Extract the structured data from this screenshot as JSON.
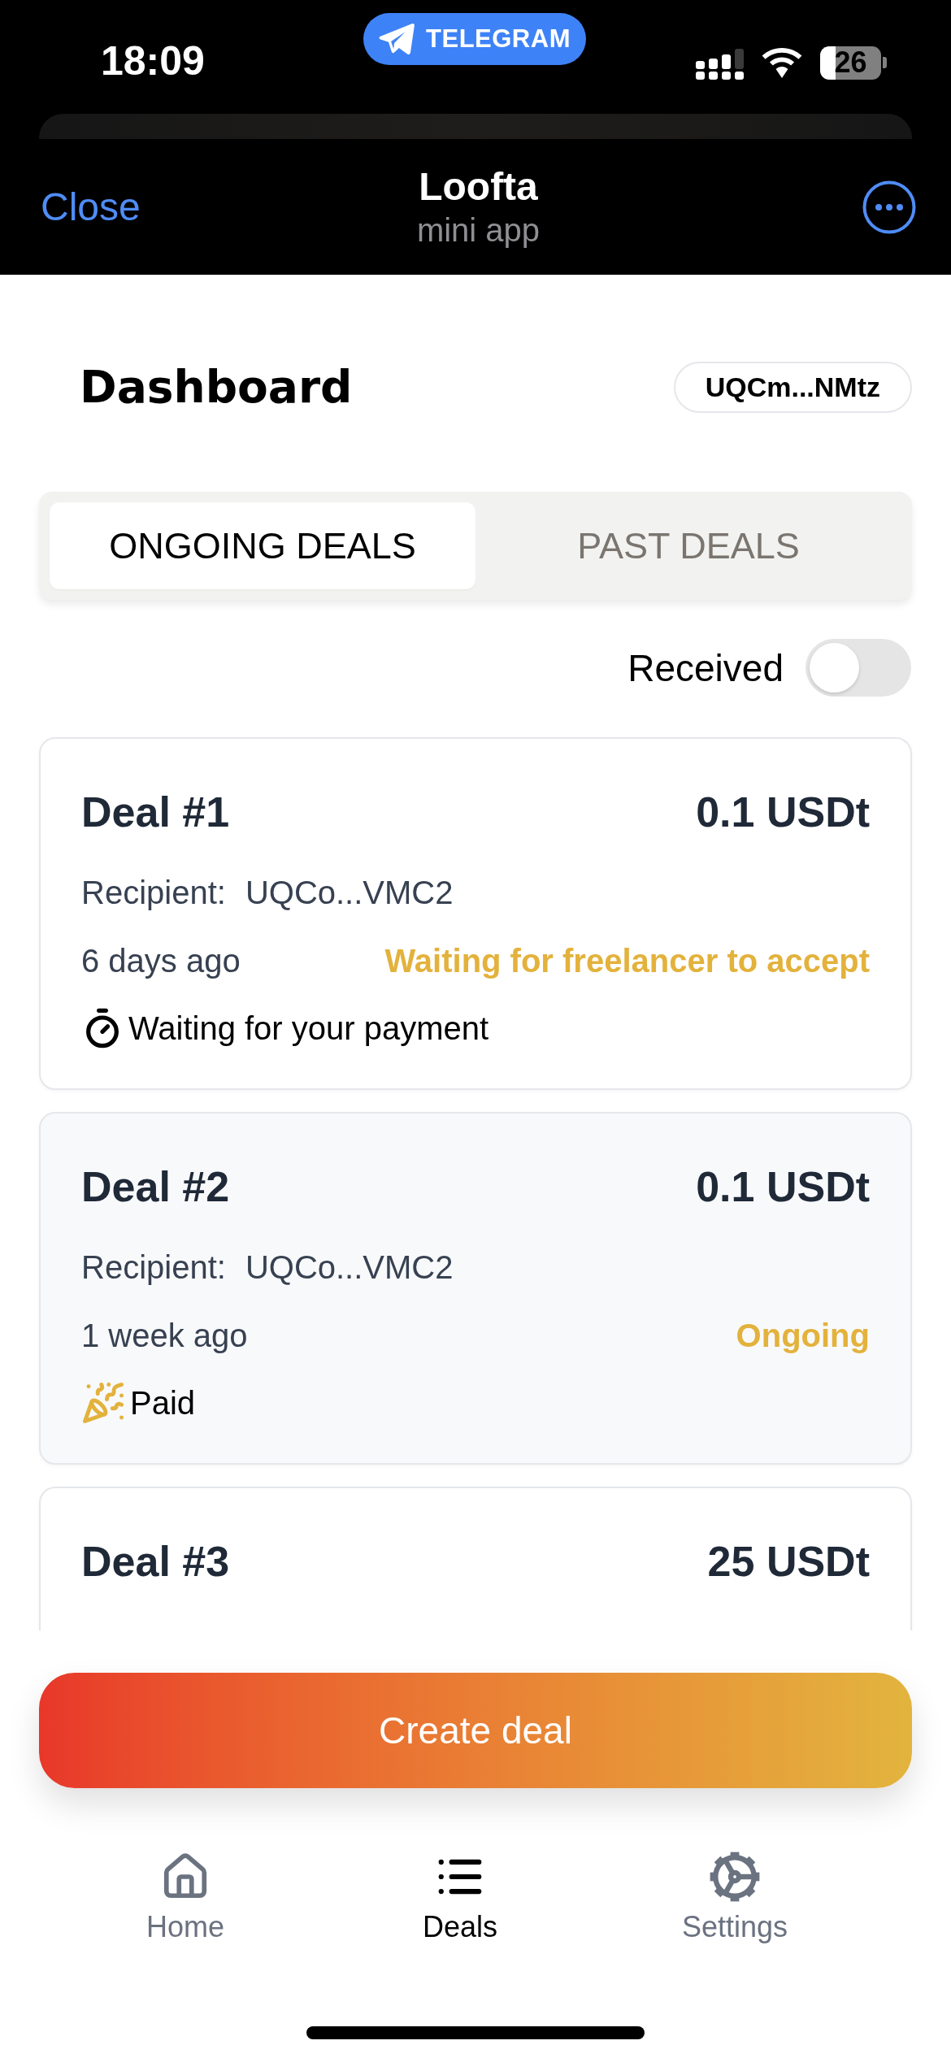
{
  "status_bar": {
    "time": "18:09",
    "app_badge": "TELEGRAM",
    "battery": "26"
  },
  "header": {
    "close": "Close",
    "title": "Loofta",
    "subtitle": "mini app"
  },
  "dashboard": {
    "title": "Dashboard",
    "wallet": "UQCm...NMtz"
  },
  "tabs": [
    {
      "label": "ONGOING DEALS",
      "selected": true
    },
    {
      "label": "PAST DEALS",
      "selected": false
    }
  ],
  "filter": {
    "label": "Received",
    "on": false
  },
  "deals": [
    {
      "title": "Deal #1",
      "amount": "0.1 USDt",
      "recipient_label": "Recipient:",
      "recipient": "UQCo...VMC2",
      "time": "6 days ago",
      "status": "Waiting for freelancer to accept",
      "note": {
        "kind": "awaiting_payment",
        "text": "Waiting for your payment"
      },
      "color": "#ffffff"
    },
    {
      "title": "Deal #2",
      "amount": "0.1 USDt",
      "recipient_label": "Recipient:",
      "recipient": "UQCo...VMC2",
      "time": "1 week ago",
      "status": "Ongoing",
      "note": {
        "kind": "paid",
        "text": "Paid"
      },
      "color": "#f8f9fb"
    },
    {
      "title": "Deal #3",
      "amount": "25 USDt",
      "color": "#ffffff"
    }
  ],
  "create_button": {
    "label": "Create deal"
  },
  "nav": [
    {
      "kind": "home",
      "label": "Home",
      "selected": false
    },
    {
      "kind": "deals",
      "label": "Deals",
      "selected": true
    },
    {
      "kind": "settings",
      "label": "Settings",
      "selected": false
    }
  ]
}
